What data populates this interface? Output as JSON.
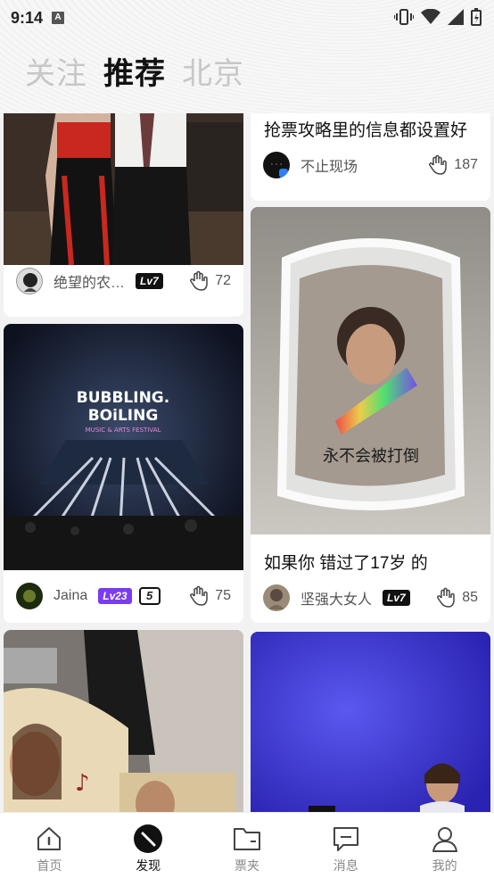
{
  "status": {
    "time": "9:14",
    "notif_glyph": "A"
  },
  "tabs": [
    {
      "label": "关注",
      "active": false
    },
    {
      "label": "推荐",
      "active": true
    },
    {
      "label": "北京",
      "active": false
    }
  ],
  "cards": {
    "c1": {
      "user": "绝望的农…",
      "level": "Lv7",
      "likes": "72"
    },
    "c2": {
      "title": "抢票攻略里的信息都设置好",
      "user": "不止现场",
      "likes": "187"
    },
    "c3": {
      "user": "Jaina",
      "level": "Lv23",
      "badge": "5",
      "likes": "75",
      "image_text_1": "BUBBLING.",
      "image_text_2": "BOiLING",
      "image_text_3": "MUSIC & ARTS FESTIVAL"
    },
    "c4": {
      "title": "如果你 错过了17岁 的",
      "user": "坚强大女人",
      "level": "Lv7",
      "likes": "85",
      "image_caption": "永不会被打倒"
    }
  },
  "nav": [
    {
      "label": "首页",
      "icon": "home-icon",
      "active": false
    },
    {
      "label": "发现",
      "icon": "discover-icon",
      "active": true
    },
    {
      "label": "票夹",
      "icon": "folder-icon",
      "active": false
    },
    {
      "label": "消息",
      "icon": "message-icon",
      "active": false
    },
    {
      "label": "我的",
      "icon": "profile-icon",
      "active": false
    }
  ]
}
